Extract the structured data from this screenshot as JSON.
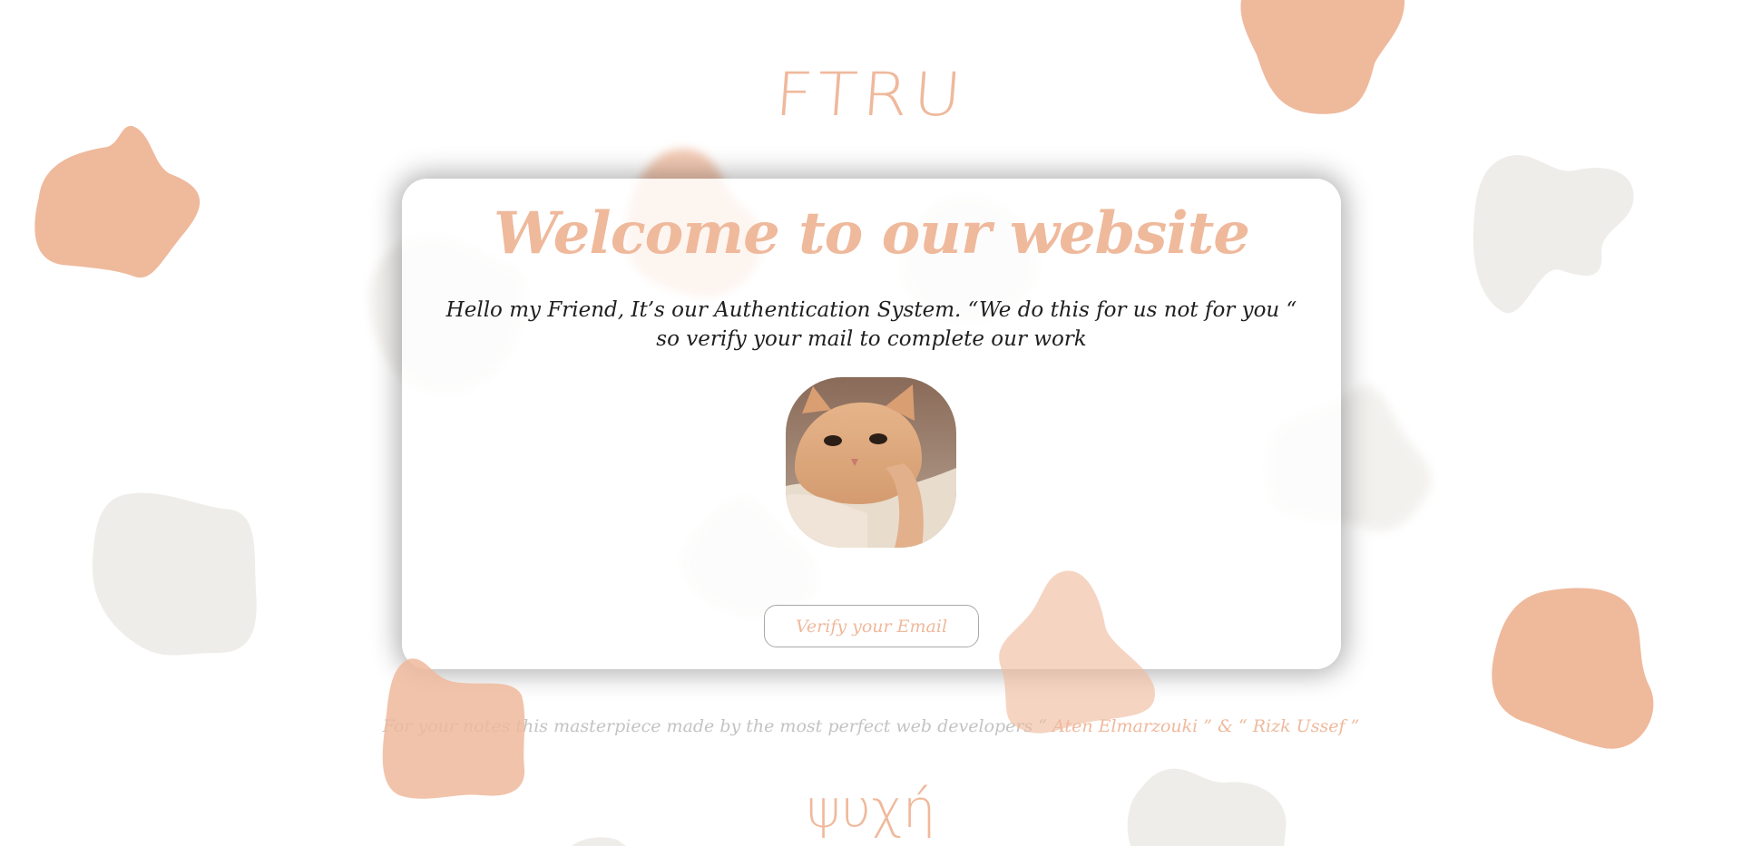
{
  "brand": {
    "title": "FTRU"
  },
  "card": {
    "title": "Welcome to our website",
    "message": "Hello my Friend, It’s our Authentication System. “We do this for us not for you “ so verify your mail to complete our work",
    "verify_button_label": "Verify your Email"
  },
  "footer": {
    "note_prefix": "For your notes this masterpiece made by the most perfect web developers “ ",
    "names": "Aten Elmarzouki ” & “ Rizk Ussef ”",
    "signature": "ψυχή"
  },
  "colors": {
    "accent": "#efb99c",
    "blob_grey": "#efede9",
    "text": "#202020",
    "muted": "#c3c3c3",
    "background": "#ffffff"
  },
  "icons": {
    "avatar": "cat-photo"
  }
}
